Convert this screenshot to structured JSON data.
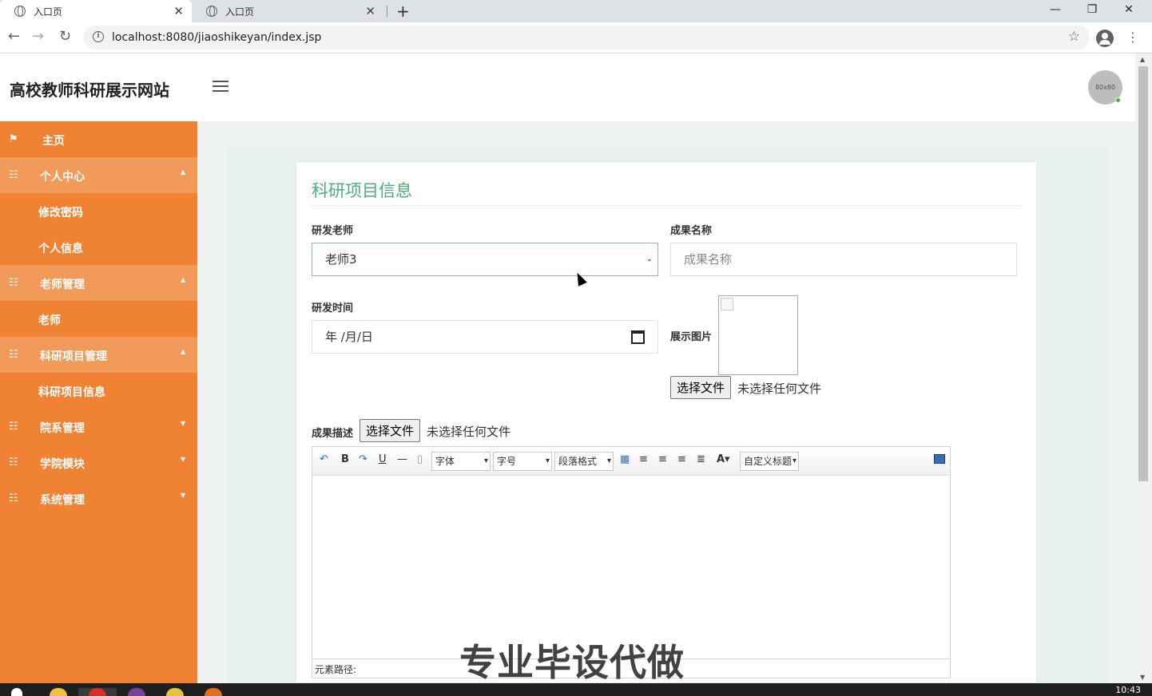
{
  "browser": {
    "tabs": [
      {
        "title": "入口页"
      },
      {
        "title": "入口页"
      }
    ],
    "url": "localhost:8080/jiaoshikeyan/index.jsp"
  },
  "header": {
    "site_title": "高校教师科研展示网站",
    "avatar_text": "80x80"
  },
  "sidebar": {
    "items": [
      {
        "label": "主页"
      },
      {
        "label": "个人中心"
      },
      {
        "label": "修改密码"
      },
      {
        "label": "个人信息"
      },
      {
        "label": "老师管理"
      },
      {
        "label": "老师"
      },
      {
        "label": "科研项目管理"
      },
      {
        "label": "科研项目信息"
      },
      {
        "label": "院系管理"
      },
      {
        "label": "学院模块"
      },
      {
        "label": "系统管理"
      }
    ]
  },
  "form": {
    "title": "科研项目信息",
    "teacher_label": "研发老师",
    "teacher_value": "老师3",
    "result_name_label": "成果名称",
    "result_name_placeholder": "成果名称",
    "date_label": "研发时间",
    "date_value": "年 /月/日",
    "image_label": "展示图片",
    "file_button": "选择文件",
    "no_file_text": "未选择任何文件",
    "desc_label": "成果描述",
    "desc_file_button": "选择文件",
    "desc_no_file_text": "未选择任何文件"
  },
  "editor": {
    "font_family": "字体",
    "font_size": "字号",
    "paragraph": "段落格式",
    "custom_title": "自定义标题",
    "path_label": "元素路径:"
  },
  "watermark": "专业毕设代做",
  "taskbar": {
    "clock": "10:43"
  },
  "colors": {
    "sidebar": "#ef8233",
    "sidebar_open": "#f29a59",
    "title_green": "#4caf7d"
  }
}
